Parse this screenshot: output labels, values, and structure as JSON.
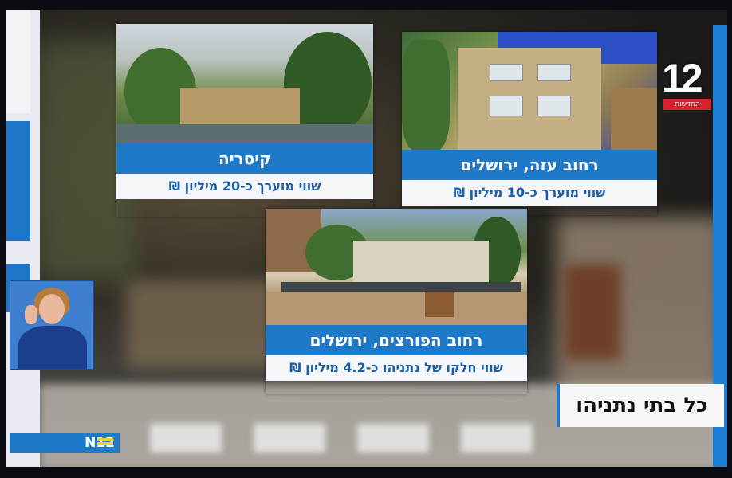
{
  "channel": {
    "logo_number": "12",
    "logo_tag": "החדשות"
  },
  "cards": [
    {
      "title": "קיסריה",
      "value": "שווי מוערך כ-20 מיליון ₪"
    },
    {
      "title": "רחוב עזה, ירושלים",
      "value": "שווי מוערך כ-10 מיליון ₪"
    },
    {
      "title": "רחוב הפורצים, ירושלים",
      "value": "שווי חלקו של נתניהו כ-4.2 מיליון ₪"
    }
  ],
  "caption": "כל בתי נתניהו",
  "bug": {
    "label": "N12"
  }
}
